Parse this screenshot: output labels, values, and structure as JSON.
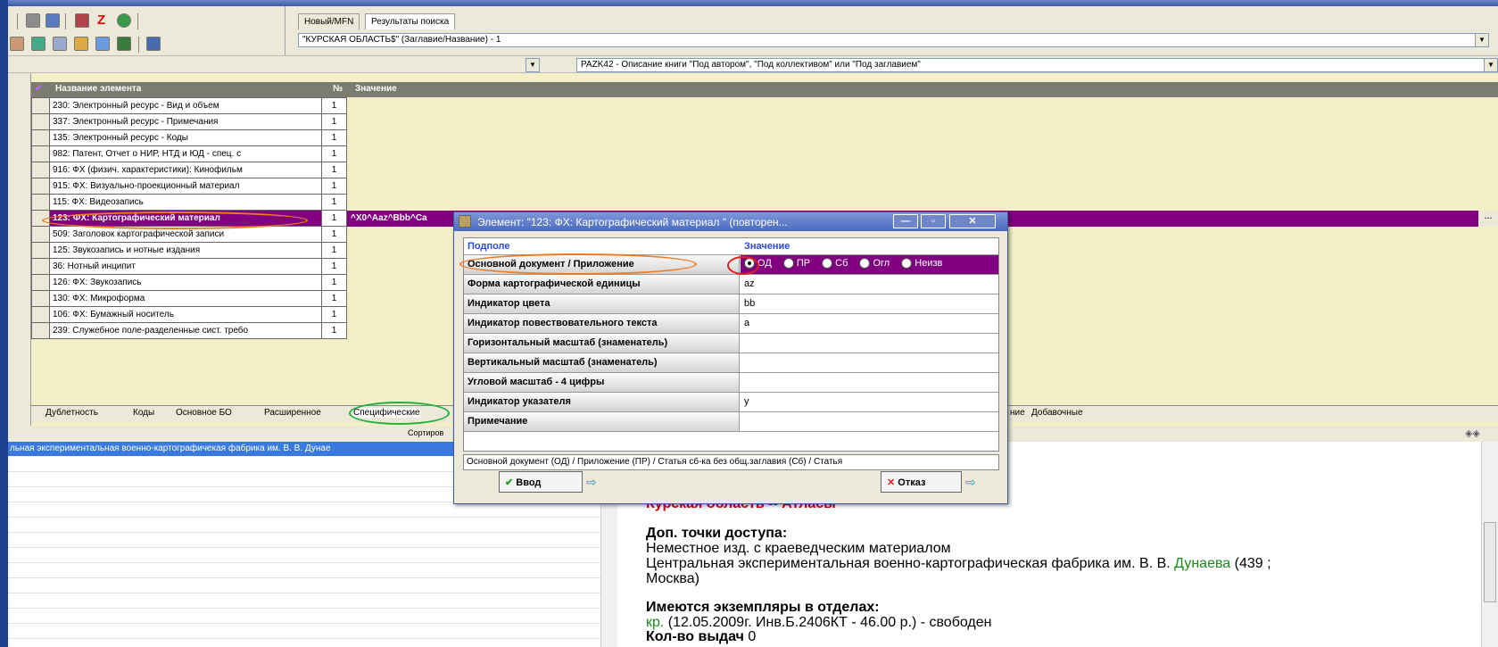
{
  "search": {
    "tabs": [
      "Новый/MFN",
      "Результаты поиска"
    ],
    "query": "\"КУРСКАЯ ОБЛАСТЬ$\" (Заглавие/Название) - 1"
  },
  "worksheet": {
    "value": "PAZK42 - Описание книги \"Под автором\", \"Под коллективом\" или \"Под заглавием\""
  },
  "grid": {
    "headers": [
      "Название элемента",
      "№",
      "Значение"
    ],
    "rows": [
      {
        "name": "230: Электронный ресурс - Вид и объем",
        "n": "1"
      },
      {
        "name": "337: Электронный ресурс - Примечания",
        "n": "1"
      },
      {
        "name": "135: Электронный ресурс - Коды",
        "n": "1"
      },
      {
        "name": "982: Патент, Отчет о НИР, НТД и ЮД - спец. с",
        "n": "1"
      },
      {
        "name": "916: ФХ (физич. характеристики): Кинофильм",
        "n": "1"
      },
      {
        "name": "915: ФХ: Визуально-проекционный материал",
        "n": "1"
      },
      {
        "name": "115: ФХ: Видеозапись",
        "n": "1"
      },
      {
        "name": "123: ФХ: Картографический материал",
        "n": "1"
      },
      {
        "name": "509: Заголовок картографической записи",
        "n": "1"
      },
      {
        "name": "125: Звукозапись и нотные издания",
        "n": "1"
      },
      {
        "name": "36: Нотный инципит",
        "n": "1"
      },
      {
        "name": "126: ФХ: Звукозапись",
        "n": "1"
      },
      {
        "name": "130: ФХ: Микроформа",
        "n": "1"
      },
      {
        "name": "106: ФХ: Бумажный носитель",
        "n": "1"
      },
      {
        "name": "239: Служебное поле-разделенные сист. требо",
        "n": "1"
      }
    ],
    "selected_value": "^X0^Aaz^Bbb^Ca",
    "ellipsis": "..."
  },
  "bottom_tabs": [
    "Дублетность",
    "Коды",
    "Основное БО",
    "Расширенное",
    "Специфические",
    "ние",
    "Добавочные"
  ],
  "sort_label": "Сортиров",
  "left_list": {
    "selected": "льная экспериментальная военно-картографичекая фабрика им. В. В. Дунае"
  },
  "dialog": {
    "title": "Элемент: \"123: ФХ: Картографический материал \" (повторен...",
    "col_subfield": "Подполе",
    "col_value": "Значение",
    "rows": [
      {
        "label": "Основной документ / Приложение",
        "value": ""
      },
      {
        "label": "Форма картографической единицы",
        "value": "az"
      },
      {
        "label": "Индикатор цвета",
        "value": "bb"
      },
      {
        "label": "Индикатор повествовательного текста",
        "value": "a"
      },
      {
        "label": "Горизонтальный масштаб (знаменатель)",
        "value": ""
      },
      {
        "label": "Вертикальный масштаб (знаменатель)",
        "value": ""
      },
      {
        "label": "Угловой масштаб - 4 цифры",
        "value": ""
      },
      {
        "label": "Индикатор указателя",
        "value": "y"
      },
      {
        "label": "Примечание",
        "value": ""
      }
    ],
    "radios": [
      "ОД",
      "ПР",
      "Сб",
      "Огл",
      "Неизв"
    ],
    "hint": "Основной документ (ОД) / Приложение (ПР) / Статья сб-ка без общ.заглавия (Сб) / Статья",
    "ok_label": "Ввод",
    "cancel_label": "Отказ"
  },
  "doc": {
    "line0": "Курская область -- Атласы",
    "h1": "Доп. точки доступа:",
    "l1": "Неместное изд. с краеведческим материалом",
    "l2a": "Центральная экспериментальная военно-картографическая фабрика им. В. В.",
    "l2link": "Дунаева",
    "l2b": "(439 ;",
    "l3": "Москва)",
    "h2": "Имеются экземпляры в отделах:",
    "l4a": "кр.",
    "l4b": "(12.05.2009г. Инв.Б.2406КТ - 46.00 р.) - свободен",
    "h3": "Кол-во выдач",
    "l5": "0"
  },
  "colors": {
    "selected_row": "#800080",
    "accent": "#1f3f8f",
    "highlight": "#f3f0c8"
  }
}
